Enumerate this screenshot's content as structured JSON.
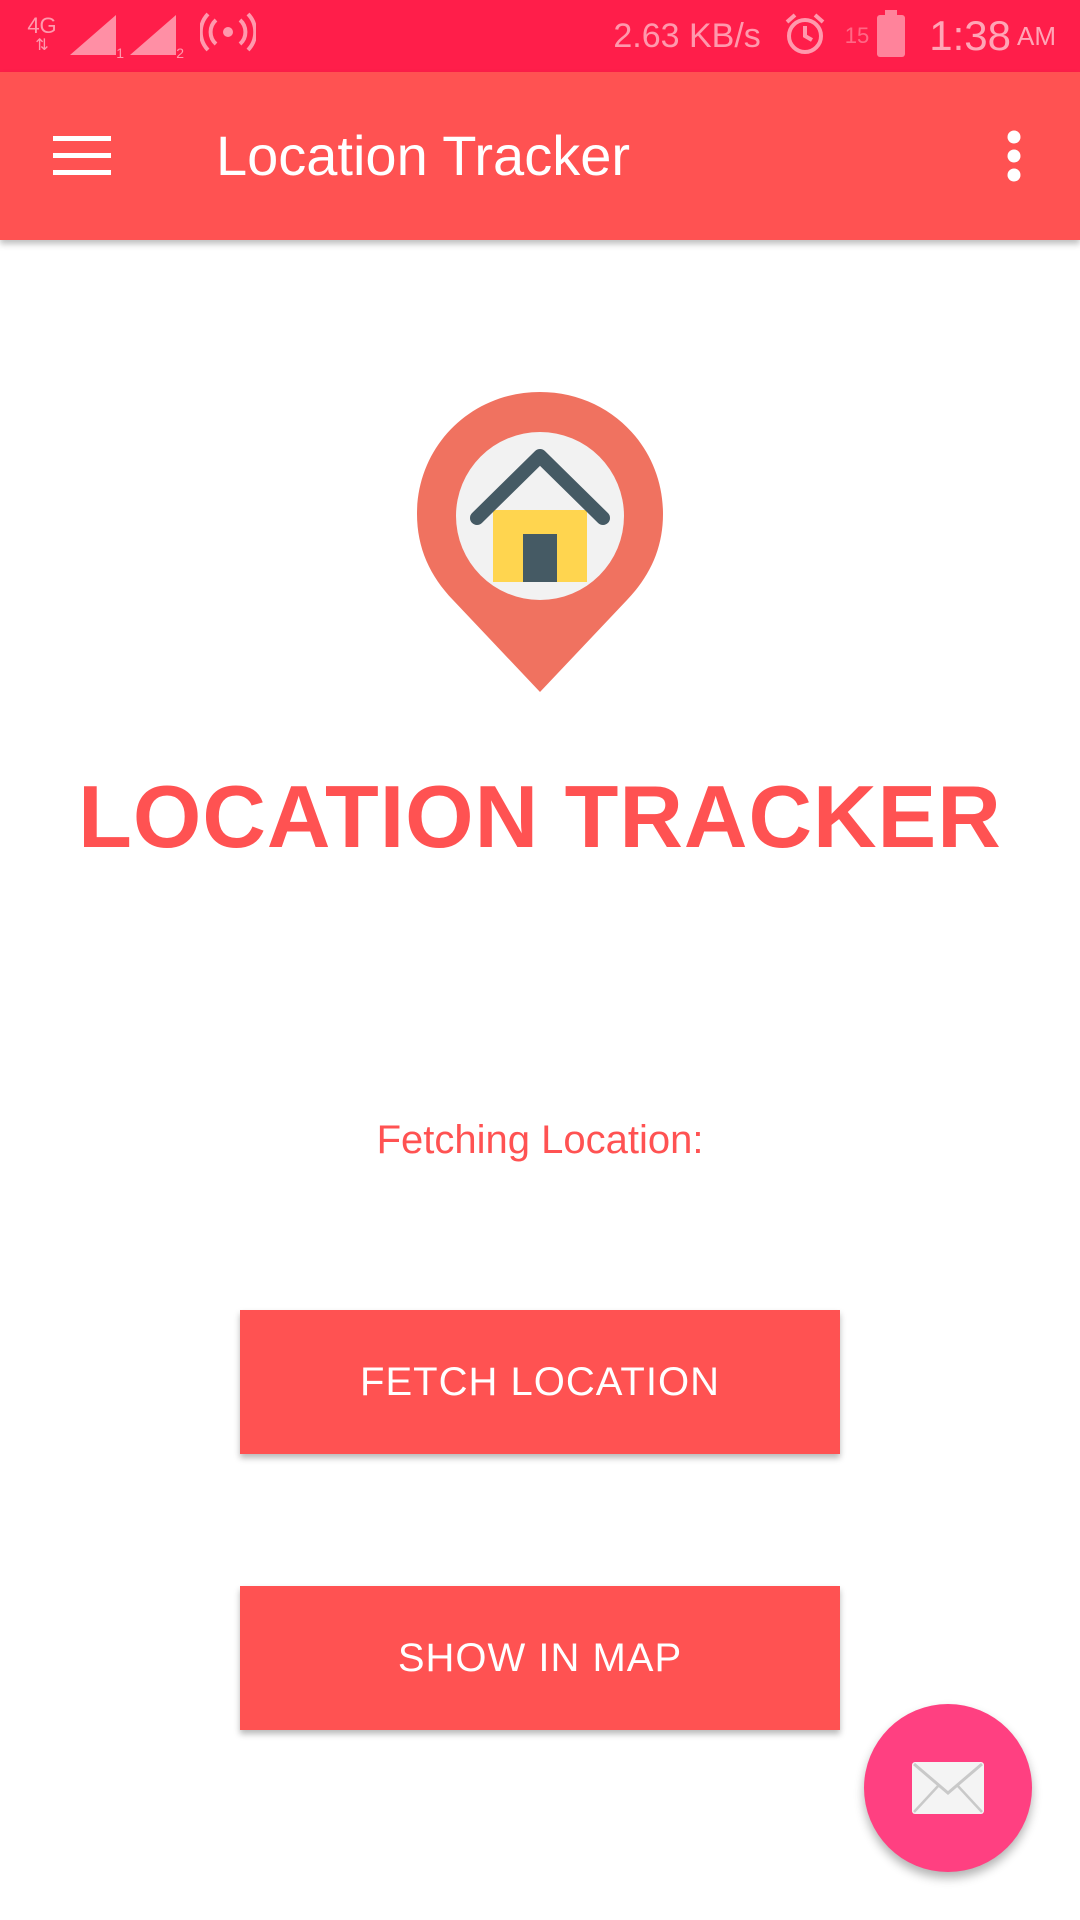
{
  "status_bar": {
    "network": "4G",
    "sim1": "1",
    "sim2": "2",
    "speed": "2.63 KB/s",
    "battery_pct": "15",
    "time": "1:38",
    "ampm": "AM",
    "icons": [
      "signal-icon",
      "hotspot-icon",
      "alarm-icon",
      "battery-icon"
    ]
  },
  "toolbar": {
    "title": "Location Tracker",
    "menu_icon": "hamburger-menu-icon",
    "overflow_icon": "more-vertical-icon"
  },
  "main": {
    "logo_icon": "location-pin-home-icon",
    "heading": "LOCATION TRACKER",
    "status_label": "Fetching Location:",
    "fetch_button_label": "FETCH LOCATION",
    "map_button_label": "SHOW IN MAP"
  },
  "fab": {
    "icon": "mail-icon"
  },
  "colors": {
    "status_bar": "#ff1e4a",
    "primary": "#ff5252",
    "accent": "#ff4081",
    "pin": "#f07260",
    "house_roof": "#455a64",
    "house_body": "#ffd54f"
  }
}
